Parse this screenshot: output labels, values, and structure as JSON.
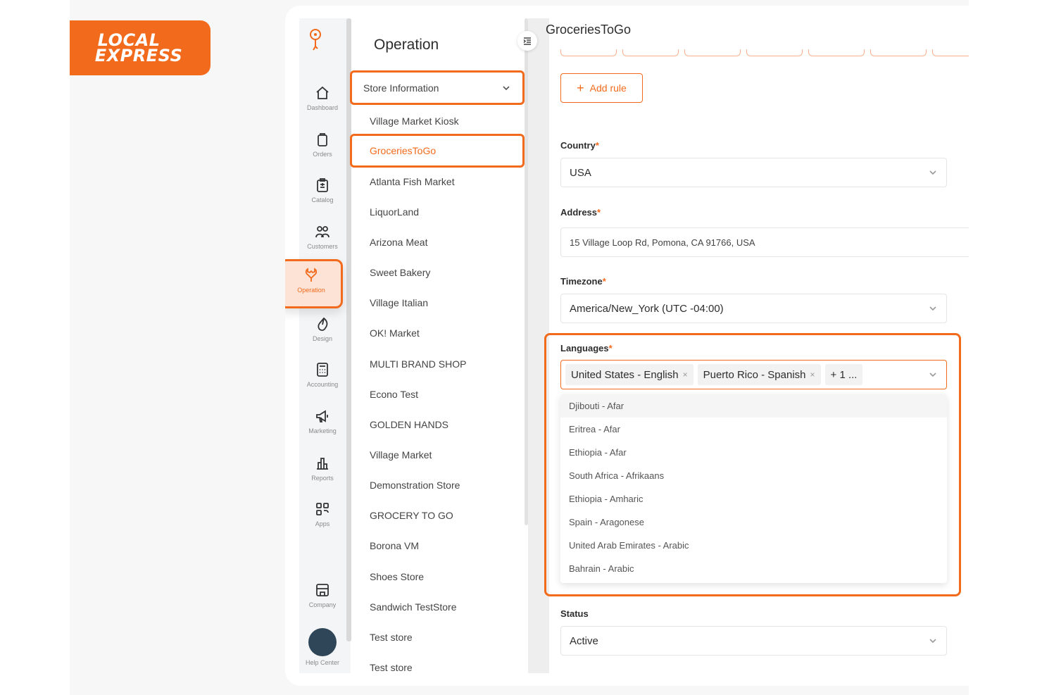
{
  "brand": {
    "logo_line1": "LOCAL",
    "logo_line2": "EXPRESS",
    "accent": "#f26a1b"
  },
  "rail": {
    "items": [
      {
        "label": "Dashboard",
        "icon": "home-icon"
      },
      {
        "label": "Orders",
        "icon": "bag-icon"
      },
      {
        "label": "Catalog",
        "icon": "clipboard-icon"
      },
      {
        "label": "Customers",
        "icon": "users-icon"
      },
      {
        "label": "Operation",
        "icon": "wrench-icon",
        "active": true
      },
      {
        "label": "Design",
        "icon": "design-icon"
      },
      {
        "label": "Accounting",
        "icon": "calculator-icon"
      },
      {
        "label": "Marketing",
        "icon": "megaphone-icon"
      },
      {
        "label": "Reports",
        "icon": "chart-icon"
      },
      {
        "label": "Apps",
        "icon": "apps-icon"
      }
    ],
    "company": "Company",
    "help": "Help Center",
    "help_glyph": "?"
  },
  "panel": {
    "title": "Operation",
    "section_select": "Store Information",
    "stores": [
      "Village Market Kiosk",
      "GroceriesToGo",
      "Atlanta Fish Market",
      "LiquorLand",
      "Arizona Meat",
      "Sweet Bakery",
      "Village Italian",
      "OK! Market",
      "MULTI BRAND SHOP",
      "Econo Test",
      "GOLDEN HANDS",
      "Village Market",
      "Demonstration Store",
      "GROCERY TO GO",
      "Borona VM",
      "Shoes Store",
      "Sandwich TestStore",
      "Test store",
      "Test store"
    ],
    "active_store_index": 1
  },
  "main": {
    "title": "GroceriesToGo",
    "add_rule_label": "Add rule",
    "country": {
      "label": "Country",
      "value": "USA"
    },
    "address": {
      "label": "Address",
      "value": "15 Village Loop Rd, Pomona, CA 91766, USA"
    },
    "timezone": {
      "label": "Timezone",
      "value": "America/New_York (UTC -04:00)"
    },
    "languages": {
      "label": "Languages",
      "selected": [
        "United States - English",
        "Puerto Rico - Spanish"
      ],
      "more": "+ 1 ...",
      "options": [
        "Djibouti - Afar",
        "Eritrea - Afar",
        "Ethiopia - Afar",
        "South Africa - Afrikaans",
        "Ethiopia - Amharic",
        "Spain - Aragonese",
        "United Arab Emirates - Arabic",
        "Bahrain - Arabic"
      ]
    },
    "status": {
      "label": "Status",
      "value": "Active"
    },
    "required_mark": "*"
  }
}
